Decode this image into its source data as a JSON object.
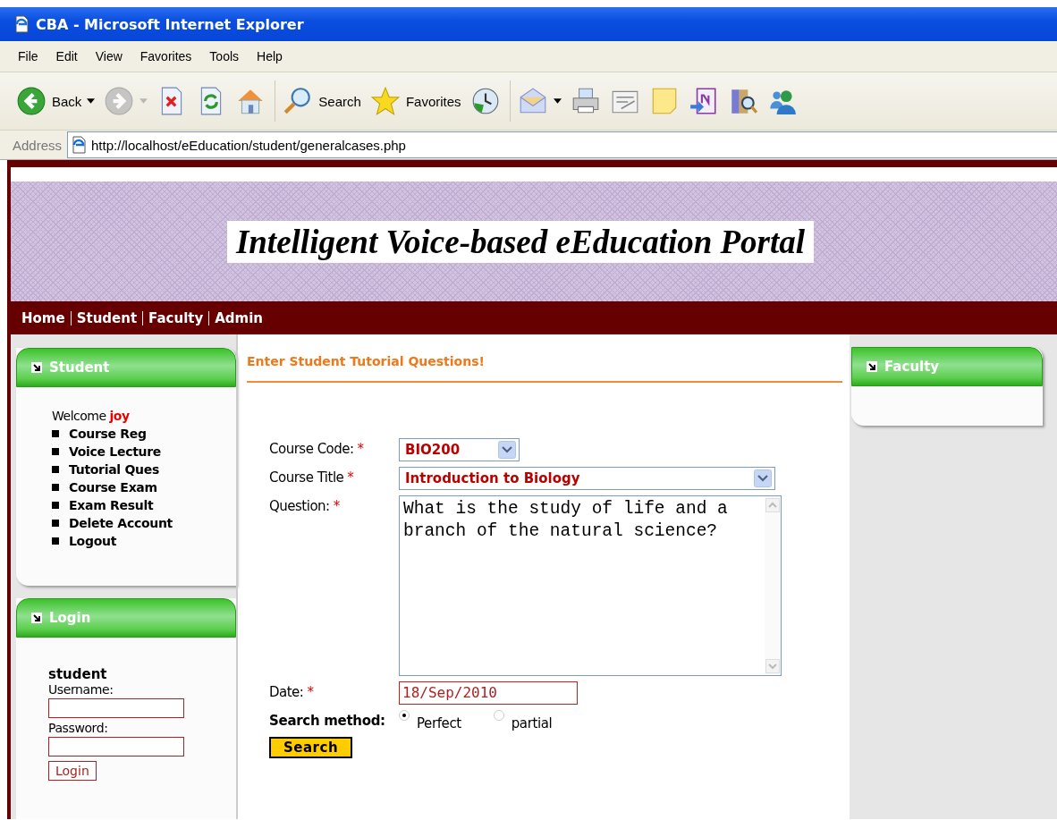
{
  "window": {
    "title": "CBA - Microsoft Internet Explorer"
  },
  "menu": [
    "File",
    "Edit",
    "View",
    "Favorites",
    "Tools",
    "Help"
  ],
  "toolbar": [
    {
      "kind": "back",
      "label": "Back",
      "dropdown": true,
      "disabled": false
    },
    {
      "kind": "forward",
      "dropdown": true,
      "disabled": true
    },
    {
      "kind": "stop",
      "dropdown": false,
      "disabled": false
    },
    {
      "kind": "refresh",
      "dropdown": false,
      "disabled": false
    },
    {
      "kind": "home",
      "dropdown": false,
      "disabled": false
    },
    {
      "kind": "separator"
    },
    {
      "kind": "search",
      "label": "Search",
      "dropdown": false,
      "disabled": false
    },
    {
      "kind": "favorites",
      "label": "Favorites",
      "dropdown": false,
      "disabled": false
    },
    {
      "kind": "history",
      "dropdown": false,
      "disabled": false
    },
    {
      "kind": "separator"
    },
    {
      "kind": "mail",
      "dropdown": true,
      "disabled": false
    },
    {
      "kind": "print",
      "dropdown": false,
      "disabled": false
    },
    {
      "kind": "edit",
      "dropdown": false,
      "disabled": false
    },
    {
      "kind": "note",
      "dropdown": false,
      "disabled": false
    },
    {
      "kind": "onenote",
      "dropdown": false,
      "disabled": false
    },
    {
      "kind": "research",
      "dropdown": false,
      "disabled": false
    },
    {
      "kind": "messenger",
      "dropdown": false,
      "disabled": false
    }
  ],
  "address": {
    "label": "Address",
    "url": "http://localhost/eEducation/student/generalcases.php"
  },
  "page": {
    "banner_title": "Intelligent Voice-based eEducation Portal",
    "nav": [
      "Home",
      "Student",
      "Faculty",
      "Admin"
    ],
    "student_panel": {
      "title": "Student",
      "welcome": "Welcome",
      "user": "joy",
      "links": [
        "Course Reg",
        "Voice Lecture",
        "Tutorial Ques",
        "Course Exam",
        "Exam Result",
        "Delete Account",
        "Logout"
      ]
    },
    "login_panel": {
      "title": "Login",
      "heading": "student",
      "username_label": "Username:",
      "password_label": "Password:",
      "button": "Login"
    },
    "form": {
      "heading": "Enter Student Tutorial Questions!",
      "fields": [
        {
          "kind": "select",
          "label": "Course Code:",
          "required_mark": "*",
          "value": "BIO200"
        },
        {
          "kind": "select",
          "label": "Course Title",
          "required_mark": "*",
          "value": "Introduction to Biology"
        },
        {
          "kind": "textarea",
          "label": "Question:",
          "required_mark": "*",
          "value": "What is the study of life and a branch of the natural science?"
        },
        {
          "kind": "text",
          "label": "Date:",
          "required_mark": "*",
          "value": "18/Sep/2010"
        },
        {
          "kind": "radio",
          "label": "Search method:",
          "options": [
            {
              "label": "Perfect",
              "selected": true
            },
            {
              "label": "partial",
              "selected": false
            }
          ]
        }
      ],
      "button": "Search"
    },
    "faculty_panel": {
      "title": "Faculty"
    }
  }
}
